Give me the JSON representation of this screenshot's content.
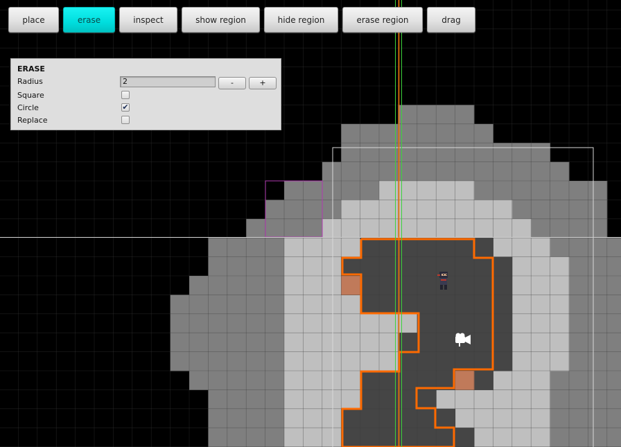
{
  "toolbar": {
    "buttons": [
      {
        "id": "place",
        "label": "place",
        "active": false
      },
      {
        "id": "erase",
        "label": "erase",
        "active": true
      },
      {
        "id": "inspect",
        "label": "inspect",
        "active": false
      },
      {
        "id": "show-region",
        "label": "show region",
        "active": false
      },
      {
        "id": "hide-region",
        "label": "hide region",
        "active": false
      },
      {
        "id": "erase-region",
        "label": "erase region",
        "active": false
      },
      {
        "id": "drag",
        "label": "drag",
        "active": false
      }
    ]
  },
  "panel": {
    "title": "ERASE",
    "radius_label": "Radius",
    "radius_value": "2",
    "minus_label": "-",
    "plus_label": "+",
    "square_label": "Square",
    "square_checked": false,
    "circle_label": "Circle",
    "circle_checked": true,
    "replace_label": "Replace",
    "replace_checked": false
  },
  "map": {
    "colors": {
      "background": "#000000",
      "grid": "#3a3a3a",
      "tile_dark_gray": "#7f7f7f",
      "tile_light_gray": "#bfbfbf",
      "tile_floor": "#454545",
      "highlight_tile": "#c07a5a",
      "region_outline": "#ff6a00",
      "selection_box": "#b03ab0",
      "camera_bounds": "#d8d8d8",
      "guide_green": "#3cd23c",
      "guide_orange": "#ff7800"
    },
    "icons": [
      "ninja-character-icon",
      "camera-icon"
    ]
  }
}
